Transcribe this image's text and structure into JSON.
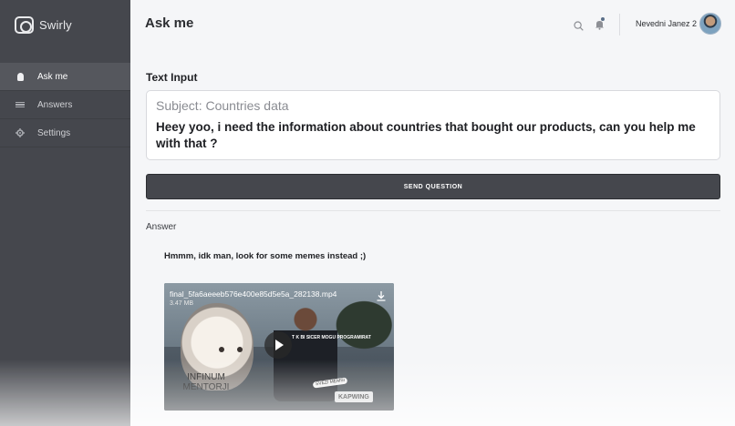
{
  "app": {
    "name": "Swirly",
    "logo_icon": "swirly-logo-icon"
  },
  "sidebar": {
    "items": [
      {
        "label": "Ask me",
        "icon": "lightbulb-icon",
        "active": true
      },
      {
        "label": "Answers",
        "icon": "list-icon",
        "active": false
      },
      {
        "label": "Settings",
        "icon": "gear-icon",
        "active": false
      }
    ]
  },
  "header": {
    "title": "Ask me",
    "user_name": "Nevedni Janez 2"
  },
  "main": {
    "section_title": "Text Input",
    "subject": "Subject: Countries data",
    "question": "Heey yoo, i need the information about countries that bought our products, can you help me with that ?",
    "send_label": "SEND QUESTION",
    "answer_label": "Answer",
    "answer_text": "Hmmm, idk man, look for some memes instead ;)"
  },
  "video": {
    "filename": "final_5fa6aeeeb576e400e85d5e5a_282138.mp4",
    "size": "3.47 MB",
    "overlay_text": "T K BI SICER MOGU PROGRAMIRAT",
    "caption": "INFINUM MENTORJI",
    "sticker": "SVEZI MEMSI",
    "brand": "KAPWING"
  },
  "colors": {
    "sidebar_bg": "#45474d",
    "sidebar_active": "#55575d",
    "page_bg": "#f5f6f8",
    "button_bg": "#45474d",
    "notification_dot": "#5a6f88"
  }
}
